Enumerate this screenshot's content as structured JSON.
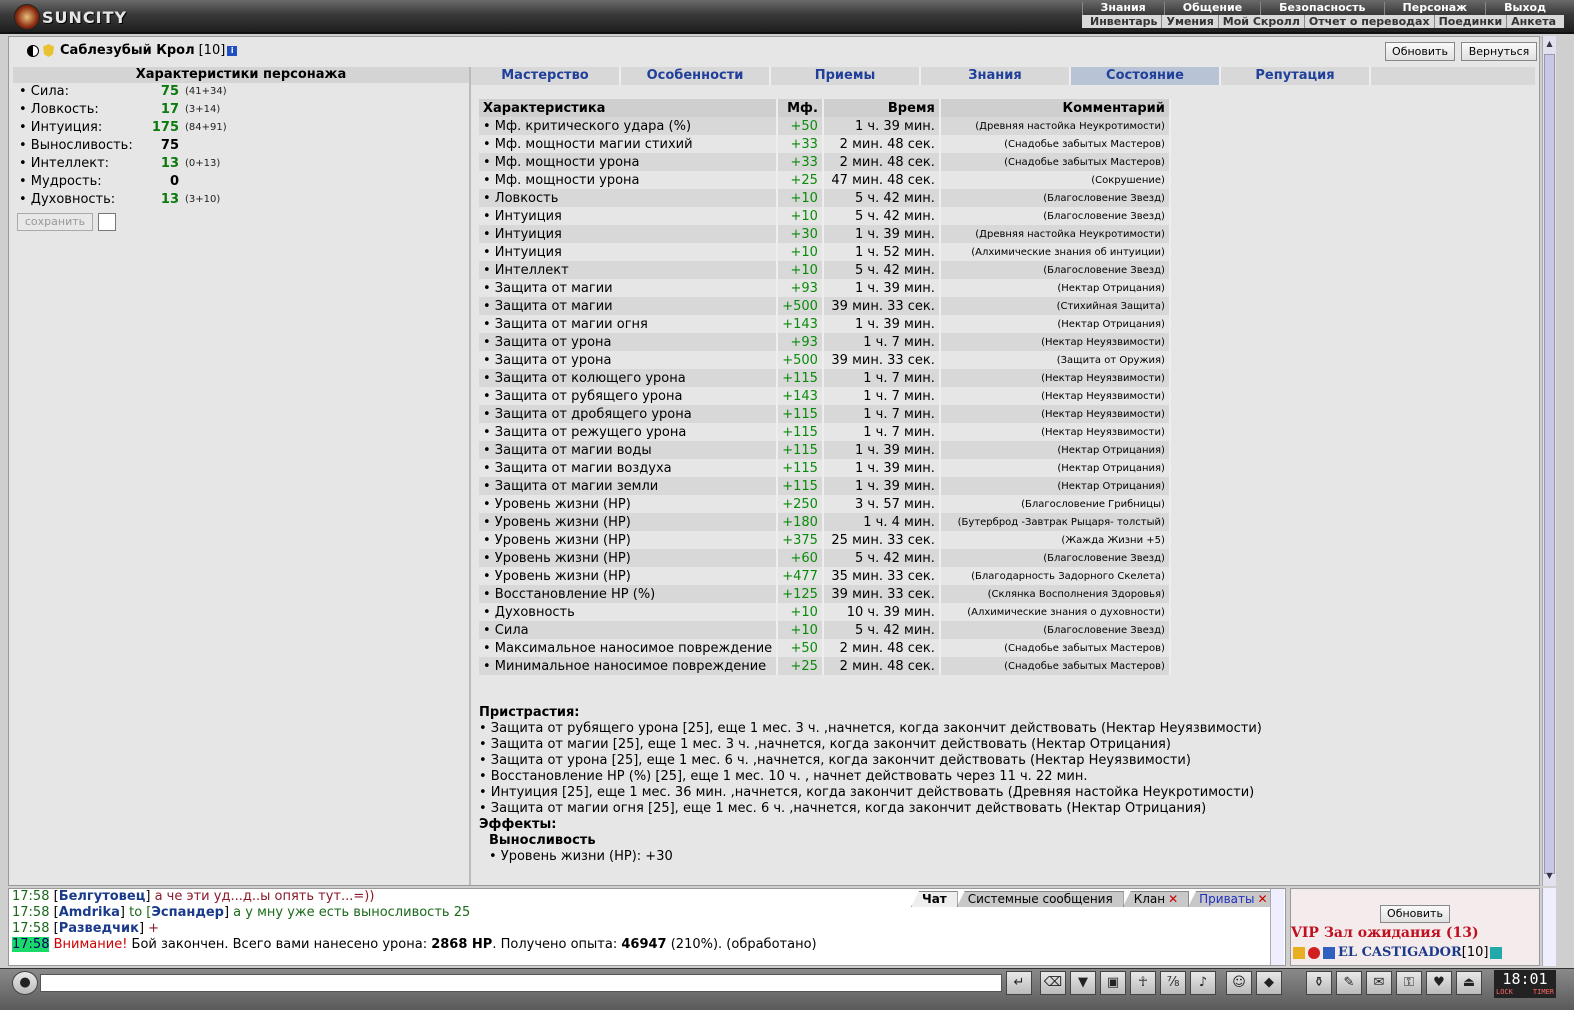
{
  "logo": {
    "text": "SUNCITY"
  },
  "top_menu": {
    "row1": [
      "Знания",
      "Общение",
      "Безопасность",
      "Персонаж",
      "Выход"
    ],
    "row2": [
      "Инвентарь",
      "Умения",
      "Мой Скролл",
      "Отчет о переводах",
      "Поединки",
      "Анкета"
    ]
  },
  "character": {
    "name": "Саблезубый Крол",
    "level": "[10]"
  },
  "buttons": {
    "refresh": "Обновить",
    "back": "Вернуться",
    "save": "сохранить"
  },
  "stats": {
    "title": "Характеристики персонажа",
    "items": [
      {
        "name": "• Сила:",
        "value": "75",
        "base": "(41+34)"
      },
      {
        "name": "• Ловкость:",
        "value": "17",
        "base": "(3+14)"
      },
      {
        "name": "• Интуиция:",
        "value": "175",
        "base": "(84+91)"
      },
      {
        "name": "• Выносливость:",
        "value": "75",
        "base": ""
      },
      {
        "name": "• Интеллект:",
        "value": "13",
        "base": "(0+13)"
      },
      {
        "name": "• Мудрость:",
        "value": "0",
        "base": ""
      },
      {
        "name": "• Духовность:",
        "value": "13",
        "base": "(3+10)"
      }
    ]
  },
  "tabs": [
    "Мастерство",
    "Особенности",
    "Приемы",
    "Знания",
    "Состояние",
    "Репутация"
  ],
  "effects_table": {
    "headers": [
      "Характеристика",
      "Мф.",
      "Время",
      "Комментарий"
    ],
    "rows": [
      [
        "• Мф. критического удара (%)",
        "+50",
        "1 ч. 39 мин.",
        "(Древняя настойка Неукротимости)"
      ],
      [
        "• Мф. мощности магии стихий",
        "+33",
        "2 мин. 48 сек.",
        "(Снадобье забытых Мастеров)"
      ],
      [
        "• Мф. мощности урона",
        "+33",
        "2 мин. 48 сек.",
        "(Снадобье забытых Мастеров)"
      ],
      [
        "• Мф. мощности урона",
        "+25",
        "47 мин. 48 сек.",
        "(Сокрушение)"
      ],
      [
        "• Ловкость",
        "+10",
        "5 ч. 42 мин.",
        "(Благословение Звезд)"
      ],
      [
        "• Интуиция",
        "+10",
        "5 ч. 42 мин.",
        "(Благословение Звезд)"
      ],
      [
        "• Интуиция",
        "+30",
        "1 ч. 39 мин.",
        "(Древняя настойка Неукротимости)"
      ],
      [
        "• Интуиция",
        "+10",
        "1 ч. 52 мин.",
        "(Алхимические знания об интуиции)"
      ],
      [
        "• Интеллект",
        "+10",
        "5 ч. 42 мин.",
        "(Благословение Звезд)"
      ],
      [
        "• Защита от магии",
        "+93",
        "1 ч. 39 мин.",
        "(Нектар Отрицания)"
      ],
      [
        "• Защита от магии",
        "+500",
        "39 мин. 33 сек.",
        "(Стихийная Защита)"
      ],
      [
        "• Защита от магии огня",
        "+143",
        "1 ч. 39 мин.",
        "(Нектар Отрицания)"
      ],
      [
        "• Защита от урона",
        "+93",
        "1 ч. 7 мин.",
        "(Нектар Неуязвимости)"
      ],
      [
        "• Защита от урона",
        "+500",
        "39 мин. 33 сек.",
        "(Защита от Оружия)"
      ],
      [
        "• Защита от колющего урона",
        "+115",
        "1 ч. 7 мин.",
        "(Нектар Неуязвимости)"
      ],
      [
        "• Защита от рубящего урона",
        "+143",
        "1 ч. 7 мин.",
        "(Нектар Неуязвимости)"
      ],
      [
        "• Защита от дробящего урона",
        "+115",
        "1 ч. 7 мин.",
        "(Нектар Неуязвимости)"
      ],
      [
        "• Защита от режущего урона",
        "+115",
        "1 ч. 7 мин.",
        "(Нектар Неуязвимости)"
      ],
      [
        "• Защита от магии воды",
        "+115",
        "1 ч. 39 мин.",
        "(Нектар Отрицания)"
      ],
      [
        "• Защита от магии воздуха",
        "+115",
        "1 ч. 39 мин.",
        "(Нектар Отрицания)"
      ],
      [
        "• Защита от магии земли",
        "+115",
        "1 ч. 39 мин.",
        "(Нектар Отрицания)"
      ],
      [
        "• Уровень жизни (HP)",
        "+250",
        "3 ч. 57 мин.",
        "(Благословение Грибницы)"
      ],
      [
        "• Уровень жизни (HP)",
        "+180",
        "1 ч. 4 мин.",
        "(Бутерброд -Завтрак Рыцаря- толстый)"
      ],
      [
        "• Уровень жизни (HP)",
        "+375",
        "25 мин. 33 сек.",
        "(Жажда Жизни +5)"
      ],
      [
        "• Уровень жизни (HP)",
        "+60",
        "5 ч. 42 мин.",
        "(Благословение Звезд)"
      ],
      [
        "• Уровень жизни (HP)",
        "+477",
        "35 мин. 33 сек.",
        "(Благодарность Задорного Скелета)"
      ],
      [
        "• Восстановление HP (%)",
        "+125",
        "39 мин. 33 сек.",
        "(Склянка Восполнения Здоровья)"
      ],
      [
        "• Духовность",
        "+10",
        "10 ч. 39 мин.",
        "(Алхимические знания о духовности)"
      ],
      [
        "• Сила",
        "+10",
        "5 ч. 42 мин.",
        "(Благословение Звезд)"
      ],
      [
        "• Максимальное наносимое повреждение",
        "+50",
        "2 мин. 48 сек.",
        "(Снадобье забытых Мастеров)"
      ],
      [
        "• Минимальное наносимое повреждение",
        "+25",
        "2 мин. 48 сек.",
        "(Снадобье забытых Мастеров)"
      ]
    ]
  },
  "addictions": {
    "title": "Пристрастия:",
    "items": [
      "• Защита от рубящего урона [25], еще 1 мес. 3 ч. ,начнется, когда закончит действовать (Нектар Неуязвимости)",
      "• Защита от магии [25], еще 1 мес. 3 ч. ,начнется, когда закончит действовать (Нектар Отрицания)",
      "• Защита от урона [25], еще 1 мес. 6 ч. ,начнется, когда закончит действовать (Нектар Неуязвимости)",
      "• Восстановление HP (%) [25], еще 1 мес. 10 ч. , начнет действовать через 11 ч. 22 мин.",
      "• Интуиция [25], еще 1 мес. 36 мин. ,начнется, когда закончит действовать (Древняя настойка Неукротимости)",
      "• Защита от магии огня [25], еще 1 мес. 6 ч. ,начнется, когда закончит действовать (Нектар Отрицания)"
    ],
    "effects_title": "Эффекты:",
    "effect_group": "Выносливость",
    "effect_item": "• Уровень жизни (HP): +30"
  },
  "chat": {
    "tabs": [
      "Чат",
      "Системные сообщения",
      "Клан",
      "Приваты"
    ],
    "lines": [
      {
        "time": "17:58",
        "nick": "Белгутовец",
        "text": " а че эти уд...д..ы опять тут...=))"
      },
      {
        "time": "17:58",
        "nick": "Amdrika",
        "to": " to [",
        "to_nick": "Эспандер",
        "text": " а у мну уже есть выносливость 25"
      },
      {
        "time": "17:58",
        "nick": "Разведчик",
        "text": " +"
      },
      {
        "time": "17:58",
        "warn": "Внимание!",
        "text1": " Бой закончен. Всего вами нанесено урона: ",
        "dmg": "2868 HP",
        "text2": ". Получено опыта: ",
        "exp": "46947",
        "text3": " (210%). (обработано)"
      }
    ]
  },
  "room": {
    "refresh": "Обновить",
    "title": "VIP Зал ожидания (13)",
    "user": "EL CASTIGADOR",
    "user_level": "[10]"
  },
  "clock": {
    "time": "18:01",
    "lock": "LOCK",
    "timer": "TIMER"
  }
}
